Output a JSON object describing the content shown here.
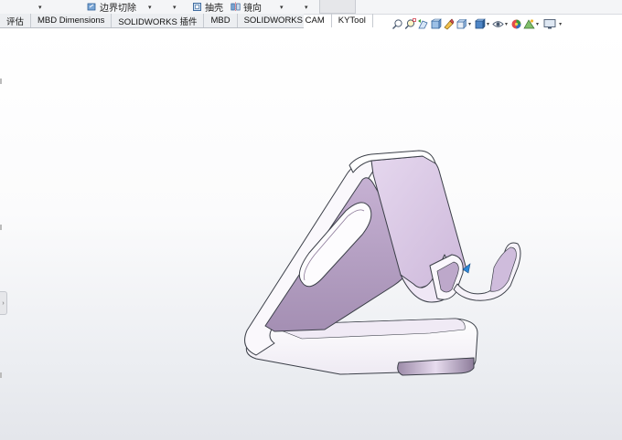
{
  "commands": {
    "boundary_cut": "边界切除",
    "shell": "抽壳",
    "mirror": "镜向",
    "dropdown_glyph": "▾"
  },
  "tabs": [
    {
      "label": "评估"
    },
    {
      "label": "MBD Dimensions"
    },
    {
      "label": "SOLIDWORKS 插件"
    },
    {
      "label": "MBD"
    },
    {
      "label": "SOLIDWORKS CAM"
    },
    {
      "label": "KYTool"
    }
  ],
  "view_toolbar": {
    "icons": [
      "zoom-to-fit-icon",
      "zoom-to-area-icon",
      "previous-view-icon",
      "section-view-icon",
      "dynamic-annotation-view-icon",
      "view-orientation-icon",
      "display-style-icon",
      "hide-show-items-icon",
      "edit-appearance-icon",
      "apply-scene-icon",
      "view-settings-icon"
    ]
  },
  "model": {
    "name": "phone-stand",
    "colors": {
      "body": "#f3f2f8",
      "face_lilac": "#d9c9e3",
      "face_shadow": "#b8a3c4",
      "edge": "#3b3f48"
    }
  },
  "viewport": {
    "background_top": "#ffffff",
    "background_bottom": "#e4e6eb"
  }
}
